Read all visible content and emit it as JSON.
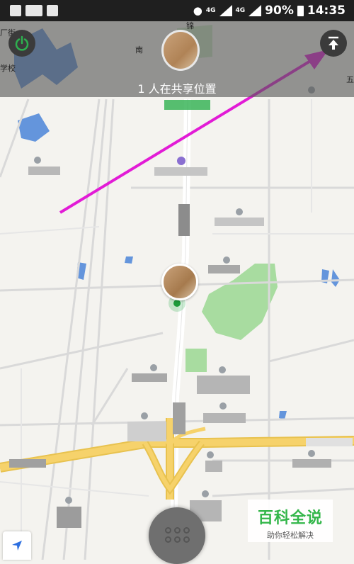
{
  "status_bar": {
    "network_1": "4G",
    "network_2": "4G",
    "battery": "90%",
    "time": "14:35"
  },
  "header": {
    "share_text": "1 人在共享位置",
    "map_labels": [
      "锦",
      "南",
      "厂街",
      "学校",
      "五"
    ]
  },
  "buttons": {
    "power_icon": "power-icon",
    "upload_icon": "upload-to-top-icon",
    "locate_icon": "navigation-arrow-icon",
    "menu_icon": "grid-dots-icon"
  },
  "watermark": {
    "title": "百科全说",
    "subtitle": "助你轻松解决"
  },
  "colors": {
    "accent_green": "#2eb04f",
    "annotation_arrow": "#e21bd6",
    "highway": "#f6d26b",
    "park": "#a8dca0",
    "water": "#4a84d8"
  }
}
